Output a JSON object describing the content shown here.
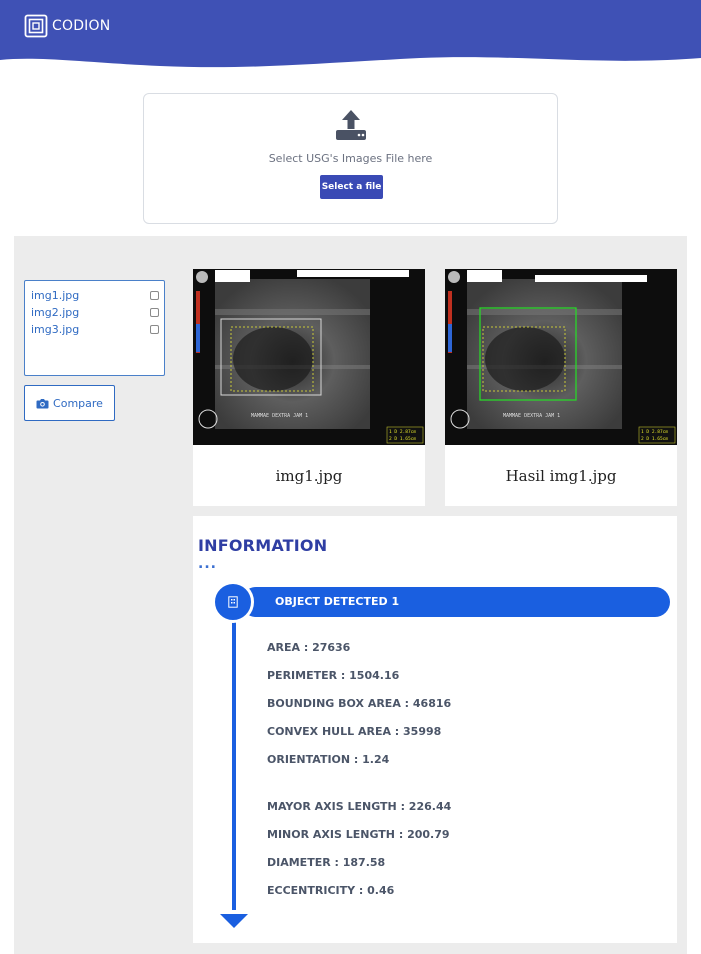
{
  "header": {
    "brand": "CODION",
    "background": "#3f51b5"
  },
  "upload": {
    "icon": "upload-icon",
    "text": "Select USG's Images File here",
    "button_label": "Select a file"
  },
  "files": [
    {
      "name": "img1.jpg",
      "checked": false
    },
    {
      "name": "img2.jpg",
      "checked": false
    },
    {
      "name": "img3.jpg",
      "checked": false
    }
  ],
  "compare": {
    "icon": "camera-icon",
    "label": "Compare"
  },
  "cards": [
    {
      "caption": "img1.jpg",
      "scale_labels": [
        "1 D 2.87cm",
        "2 D 1.65cm"
      ],
      "scan_label": "MAMMAE DEXTRA JAM 1"
    },
    {
      "caption": "Hasil img1.jpg",
      "scale_labels": [
        "1 D 2.87cm",
        "2 D 1.65cm"
      ],
      "scan_label": "MAMMAE DEXTRA JAM 1"
    }
  ],
  "info": {
    "title": "INFORMATION",
    "dots": "...",
    "object_label": "OBJECT DETECTED 1",
    "object_icon": "object-icon",
    "metrics_group1": [
      "AREA : 27636",
      "PERIMETER : 1504.16",
      "BOUNDING BOX AREA : 46816",
      "CONVEX HULL AREA : 35998",
      "ORIENTATION : 1.24"
    ],
    "metrics_group2": [
      "MAYOR AXIS LENGTH : 226.44",
      "MINOR AXIS LENGTH : 200.79",
      "DIAMETER : 187.58",
      "ECCENTRICITY : 0.46"
    ]
  },
  "colors": {
    "accent": "#1a5fe0",
    "header": "#3f51b5",
    "panel": "#ececec",
    "link": "#2f6ac2"
  }
}
